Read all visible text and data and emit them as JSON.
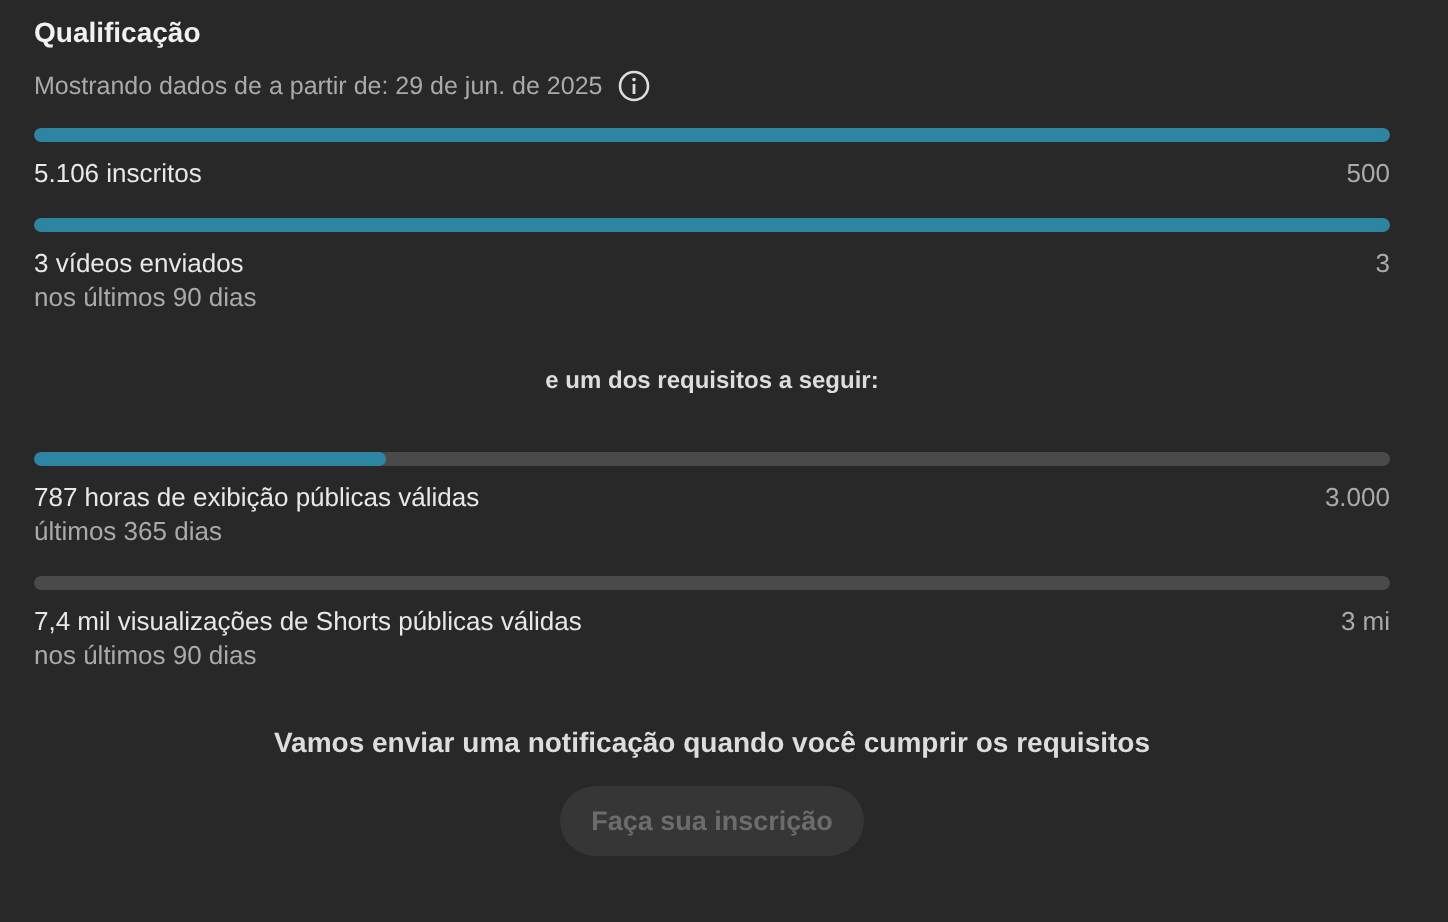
{
  "title": "Qualificação",
  "data_note": "Mostrando dados de a partir de: 29 de jun. de 2025",
  "requirements": [
    {
      "label": "5.106 inscritos",
      "target": "500",
      "level": 1
    },
    {
      "label": "3 vídeos enviados",
      "sublabel": "nos últimos 90 dias",
      "target": "3",
      "level": 1
    }
  ],
  "separator": "e um dos requisitos a seguir:",
  "optional_requirements": [
    {
      "label": "787 horas de exibição públicas válidas",
      "sublabel": "últimos 365 dias",
      "target": "3.000",
      "level": 0.26
    },
    {
      "label": "7,4 mil visualizações de Shorts públicas válidas",
      "sublabel": "nos últimos 90 dias",
      "target": "3 mi",
      "level": 0
    }
  ],
  "notice": "Vamos enviar uma notificação quando você cumprir os requisitos",
  "button": {
    "label": "Faça sua inscrição",
    "disabled": true
  }
}
